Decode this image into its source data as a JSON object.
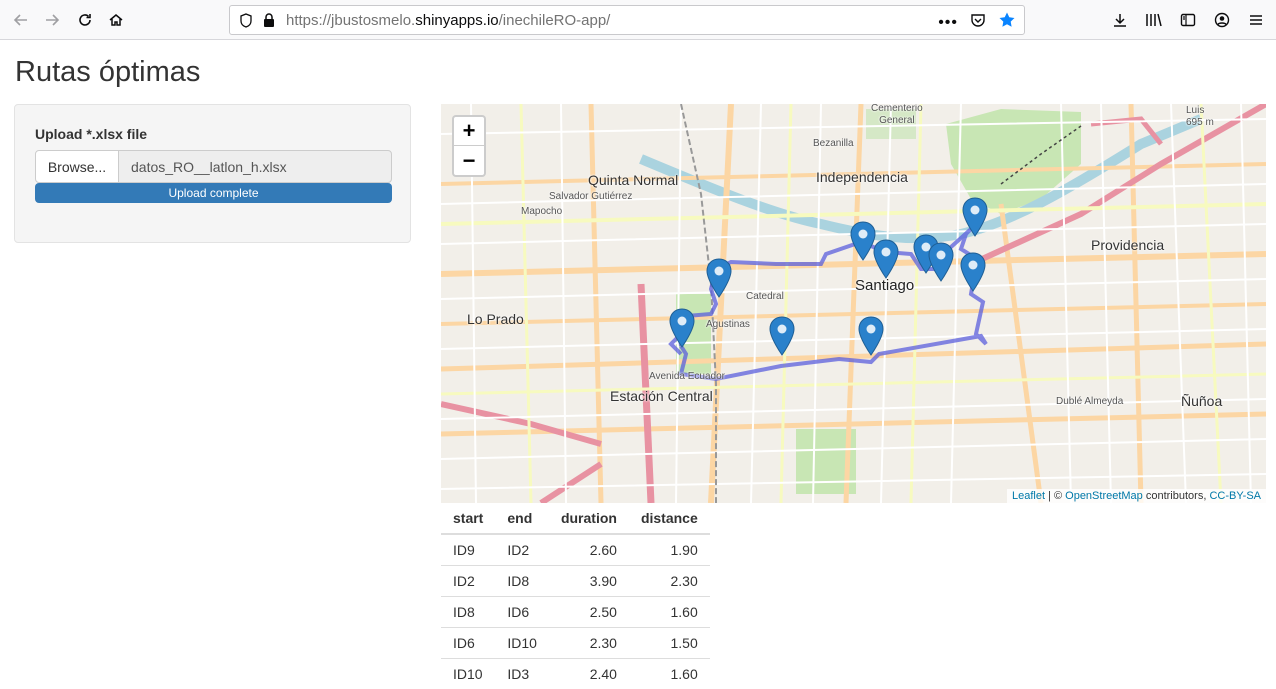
{
  "browser": {
    "url_prefix": "https://jbustosmelo.",
    "url_host": "shinyapps.io",
    "url_path": "/inechileRO-app/"
  },
  "page": {
    "title": "Rutas óptimas"
  },
  "upload": {
    "label": "Upload *.xlsx file",
    "browse_label": "Browse...",
    "filename": "datos_RO__latlon_h.xlsx",
    "progress_label": "Upload complete",
    "progress_fraction": 1.0
  },
  "map": {
    "zoom_in": "+",
    "zoom_out": "−",
    "labels": {
      "quinta_normal": "Quinta Normal",
      "independencia": "Independencia",
      "santiago": "Santiago",
      "providencia": "Providencia",
      "lo_prado": "Lo Prado",
      "estacion_central": "Estación Central",
      "nunoa": "Ñuñoa",
      "cementerio": "Cementerio\nGeneral",
      "luis": "Luis\n695 m",
      "mapocho": "Mapocho",
      "catedral": "Catedral",
      "agustinas": "Agustinas",
      "avenida_ecuador": "Avenida Ecuador",
      "salvador_gutierrez": "Salvador Gutiérrez",
      "bezanilla": "Bezanilla",
      "dublé_almeyda": "Dublé Almeyda"
    },
    "attribution": {
      "leaflet": "Leaflet",
      "sep": " | © ",
      "osm": "OpenStreetMap",
      "contrib": " contributors, ",
      "license": "CC-BY-SA"
    },
    "marker_count": 9,
    "route_color": "#5b5fdc",
    "marker_color": "#2a81cb"
  },
  "table": {
    "headers": [
      "start",
      "end",
      "duration",
      "distance"
    ],
    "rows": [
      [
        "ID9",
        "ID2",
        "2.60",
        "1.90"
      ],
      [
        "ID2",
        "ID8",
        "3.90",
        "2.30"
      ],
      [
        "ID8",
        "ID6",
        "2.50",
        "1.60"
      ],
      [
        "ID6",
        "ID10",
        "2.30",
        "1.50"
      ],
      [
        "ID10",
        "ID3",
        "2.40",
        "1.60"
      ]
    ]
  }
}
